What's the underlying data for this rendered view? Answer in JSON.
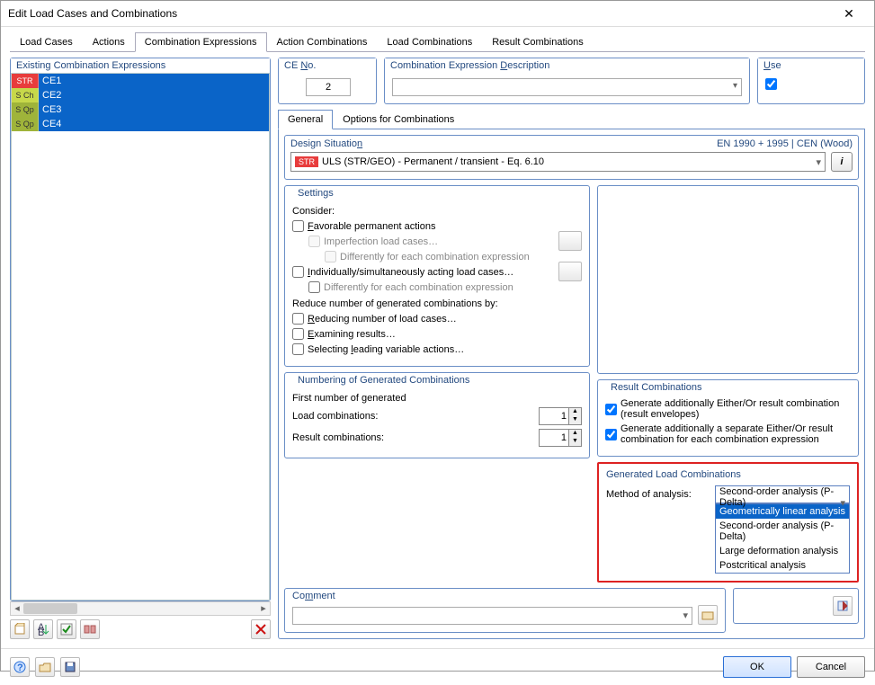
{
  "window": {
    "title": "Edit Load Cases and Combinations"
  },
  "mainTabs": [
    "Load Cases",
    "Actions",
    "Combination Expressions",
    "Action Combinations",
    "Load Combinations",
    "Result Combinations"
  ],
  "activeMainTab": 2,
  "existing": {
    "label": "Existing Combination Expressions",
    "rows": [
      {
        "tag": "STR",
        "tagClass": "tag-str",
        "name": "CE1"
      },
      {
        "tag": "S Ch",
        "tagClass": "tag-sch",
        "name": "CE2"
      },
      {
        "tag": "S Qp",
        "tagClass": "tag-sqp",
        "name": "CE3"
      },
      {
        "tag": "S Qp",
        "tagClass": "tag-sqp",
        "name": "CE4"
      }
    ]
  },
  "ceNo": {
    "label": "CE No.",
    "value": "2"
  },
  "desc": {
    "label": "Combination Expression Description"
  },
  "use": {
    "label": "Use",
    "checked": true
  },
  "subTabs": [
    "General",
    "Options for Combinations"
  ],
  "activeSubTab": 0,
  "design": {
    "label": "Design Situation",
    "standard": "EN 1990 + 1995 | CEN (Wood)",
    "badge": "STR",
    "value": "ULS (STR/GEO) - Permanent / transient - Eq. 6.10"
  },
  "settings": {
    "label": "Settings",
    "consider": "Consider:",
    "favorable": "Favorable permanent actions",
    "imperf": "Imperfection load cases…",
    "diffEach1": "Differently for each combination expression",
    "indiv": "Individually/simultaneously acting load cases…",
    "diffEach2": "Differently for each combination expression",
    "reduceHdr": "Reduce number of generated combinations by:",
    "reducing": "Reducing number of load cases…",
    "examining": "Examining results…",
    "selecting": "Selecting leading variable actions…"
  },
  "resultComb": {
    "label": "Result Combinations",
    "gen1": "Generate additionally Either/Or result combination (result envelopes)",
    "gen2": "Generate additionally a separate Either/Or result combination for each combination expression"
  },
  "glc": {
    "label": "Generated Load Combinations",
    "methodLabel": "Method of analysis:",
    "selected": "Second-order analysis (P-Delta)",
    "options": [
      "Geometrically linear analysis",
      "Second-order analysis (P-Delta)",
      "Large deformation analysis",
      "Postcritical analysis"
    ]
  },
  "numbering": {
    "label": "Numbering of Generated Combinations",
    "firstLine": "First number of generated",
    "loadComb": "Load combinations:",
    "loadVal": "1",
    "resultComb": "Result combinations:",
    "resultVal": "1"
  },
  "comment": {
    "label": "Comment"
  },
  "footer": {
    "ok": "OK",
    "cancel": "Cancel"
  }
}
